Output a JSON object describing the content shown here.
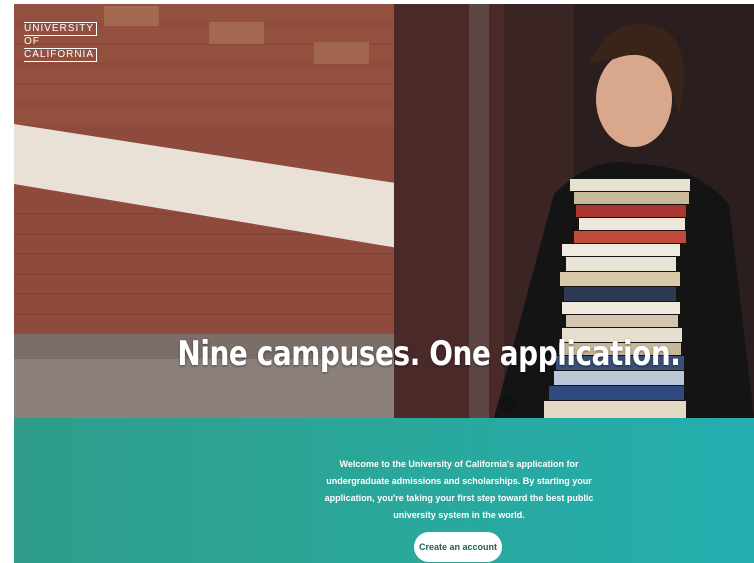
{
  "logo": {
    "line1": "UNIVERSITY",
    "line2": "OF",
    "line3": "CALIFORNIA"
  },
  "hero": {
    "title": "Nine campuses. One application."
  },
  "intro": {
    "text": "Welcome to the University of California's application for undergraduate admissions and scholarships. By starting your application, you're taking your first step toward the best public university system in the world."
  },
  "cta": {
    "label": "Create an account"
  },
  "colors": {
    "teal_start": "#2f9c8a",
    "teal_end": "#24aeb0",
    "button_text": "#1f5f58"
  }
}
